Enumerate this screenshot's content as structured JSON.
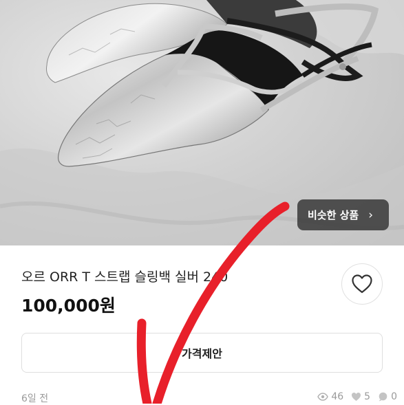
{
  "photo": {
    "alt": "silver slingback shoes",
    "similar_button_label": "비슷한 상품",
    "similar_button_chevron": "›"
  },
  "product": {
    "title": "오르 ORR T 스트랩 슬링백 실버 240",
    "price": "100,000원"
  },
  "actions": {
    "offer_label": "가격제안",
    "favorite_icon": "heart-icon"
  },
  "meta": {
    "posted": "6일 전",
    "views": "46",
    "likes": "5",
    "chats": "0"
  },
  "colors": {
    "annotation_red": "#e8202a"
  }
}
